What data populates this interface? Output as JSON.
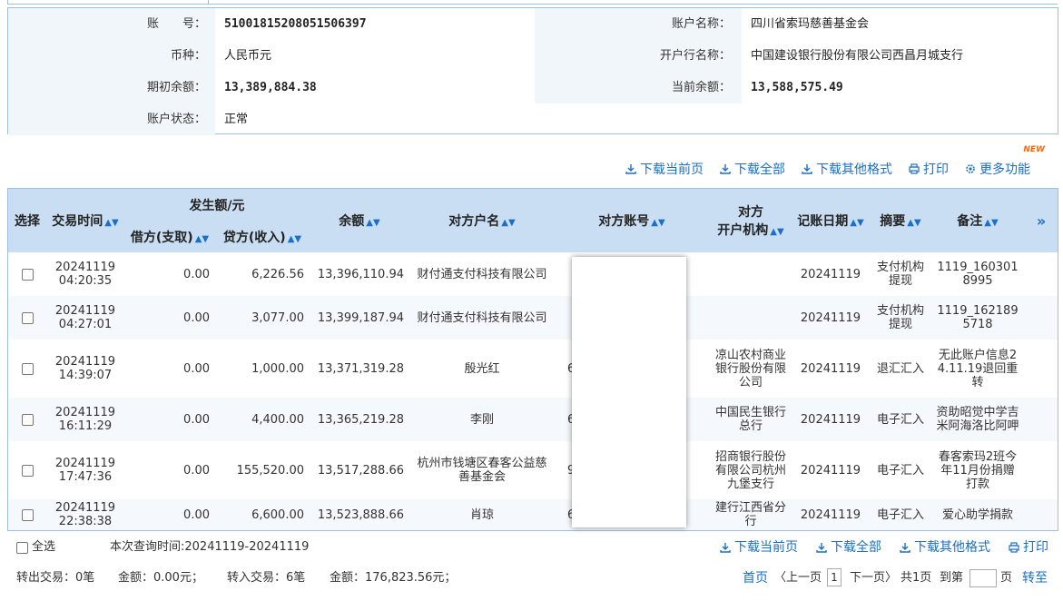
{
  "account_info": {
    "account_no_label": "账　　号：",
    "account_no": "51001815208051506397",
    "account_name_label": "账户名称：",
    "account_name": "四川省索玛慈善基金会",
    "currency_label": "币种：",
    "currency": "人民币元",
    "bank_label": "开户行名称：",
    "bank": "中国建设银行股份有限公司西昌月城支行",
    "opening_balance_label": "期初余额：",
    "opening_balance": "13,389,884.38",
    "current_balance_label": "当前余额：",
    "current_balance": "13,588,575.49",
    "status_label": "账户状态：",
    "status": "正常"
  },
  "toolbar": {
    "new_badge": "NEW",
    "download_page": "下载当前页",
    "download_all": "下载全部",
    "download_other": "下载其他格式",
    "print": "打印",
    "more": "更多功能"
  },
  "table": {
    "headers": {
      "select": "选择",
      "time": "交易时间",
      "amount_group": "发生额/元",
      "debit": "借方(支取)",
      "credit": "贷方(收入)",
      "balance": "余额",
      "counterparty": "对方户名",
      "counter_account": "对方账号",
      "counter_bank_1": "对方",
      "counter_bank_2": "开户机构",
      "post_date": "记账日期",
      "summary": "摘要",
      "remark": "备注",
      "expand": "»"
    },
    "rows": [
      {
        "date": "20241119",
        "time": "04:20:35",
        "debit": "0.00",
        "credit": "6,226.56",
        "balance": "13,396,110.94",
        "counterparty": "财付通支付科技有限公司",
        "account": "",
        "bank": "",
        "post_date": "20241119",
        "summary": "支付机构提现",
        "remark": "1119_1603018995"
      },
      {
        "date": "20241119",
        "time": "04:27:01",
        "debit": "0.00",
        "credit": "3,077.00",
        "balance": "13,399,187.94",
        "counterparty": "财付通支付科技有限公司",
        "account": "",
        "bank": "",
        "post_date": "20241119",
        "summary": "支付机构提现",
        "remark": "1119_1621895718"
      },
      {
        "date": "20241119",
        "time": "14:39:07",
        "debit": "0.00",
        "credit": "1,000.00",
        "balance": "13,371,319.28",
        "counterparty": "殷光红",
        "account": "623",
        "bank": "凉山农村商业银行股份有限公司",
        "post_date": "20241119",
        "summary": "退汇汇入",
        "remark": "无此账户信息24.11.19退回重转"
      },
      {
        "date": "20241119",
        "time": "16:11:29",
        "debit": "0.00",
        "credit": "4,400.00",
        "balance": "13,365,219.28",
        "counterparty": "李刚",
        "account": "6",
        "bank": "中国民生银行总行",
        "post_date": "20241119",
        "summary": "电子汇入",
        "remark": "资助昭觉中学吉米阿海洛比阿呷"
      },
      {
        "date": "20241119",
        "time": "17:47:36",
        "debit": "0.00",
        "credit": "155,520.00",
        "balance": "13,517,288.66",
        "counterparty": "杭州市钱塘区春客公益慈善基金会",
        "account": "9",
        "bank": "招商银行股份有限公司杭州九堡支行",
        "post_date": "20241119",
        "summary": "电子汇入",
        "remark": "春客索玛2班今年11月份捐赠打款"
      },
      {
        "date": "20241119",
        "time": "22:38:38",
        "debit": "0.00",
        "credit": "6,600.00",
        "balance": "13,523,888.66",
        "counterparty": "肖琼",
        "account": "621",
        "bank": "建行江西省分行",
        "post_date": "20241119",
        "summary": "电子汇入",
        "remark": "爱心助学捐款"
      }
    ]
  },
  "footer": {
    "select_all": "全选",
    "query_period": "本次查询时间:20241119-20241119",
    "download_page": "下载当前页",
    "download_all": "下载全部",
    "download_other": "下载其他格式",
    "print": "打印",
    "out_count": "转出交易：0笔",
    "out_amount": "金额：0.00元；",
    "in_count": "转入交易：6笔",
    "in_amount": "金额：176,823.56元；",
    "first": "首页",
    "prev": "〈上一页",
    "page_current": "1",
    "next": "下一页〉",
    "total_pages": "共1页",
    "goto": "到第",
    "page_unit": "页",
    "go": "转至"
  },
  "colors": {
    "link": "#1a6fc6",
    "header_bg": "#c9def2",
    "border": "#9ec0e0",
    "badge": "#ff6600"
  }
}
